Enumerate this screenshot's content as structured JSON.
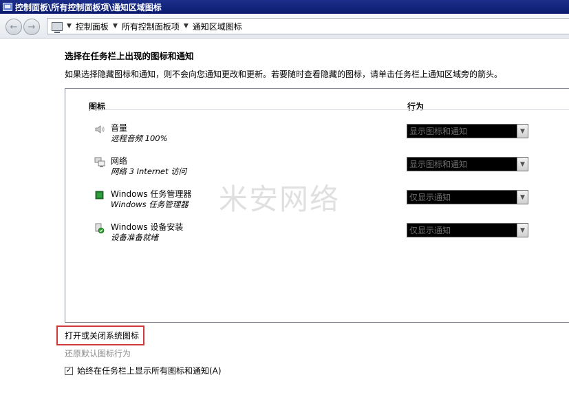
{
  "window": {
    "title": "控制面板\\所有控制面板项\\通知区域图标"
  },
  "address": {
    "crumbs": [
      "控制面板",
      "所有控制面板项",
      "通知区域图标"
    ]
  },
  "main": {
    "heading": "选择在任务栏上出现的图标和通知",
    "description": "如果选择隐藏图标和通知，则不会向您通知更改和更新。若要随时查看隐藏的图标，请单击任务栏上通知区域旁的箭头。",
    "columns": {
      "icon": "图标",
      "behavior": "行为"
    },
    "rows": [
      {
        "name": "音量",
        "sub": "远程音频 100%",
        "icon": "speaker-icon",
        "behavior": "显示图标和通知"
      },
      {
        "name": "网络",
        "sub": "网络 3 Internet 访问",
        "icon": "network-icon",
        "behavior": "显示图标和通知"
      },
      {
        "name": "Windows 任务管理器",
        "sub": "Windows 任务管理器",
        "icon": "task-manager-icon",
        "behavior": "仅显示通知"
      },
      {
        "name": "Windows 设备安装",
        "sub": "设备准备就绪",
        "icon": "device-install-icon",
        "behavior": "仅显示通知"
      }
    ],
    "watermark": "米安网络"
  },
  "footer": {
    "system_icons_link": "打开或关闭系统图标",
    "restore_link": "还原默认图标行为",
    "always_show_label": "始终在任务栏上显示所有图标和通知(A)",
    "always_show_checked": true
  },
  "colors": {
    "highlight_border": "#d0393b",
    "titlebar": "#0a1b6e"
  }
}
